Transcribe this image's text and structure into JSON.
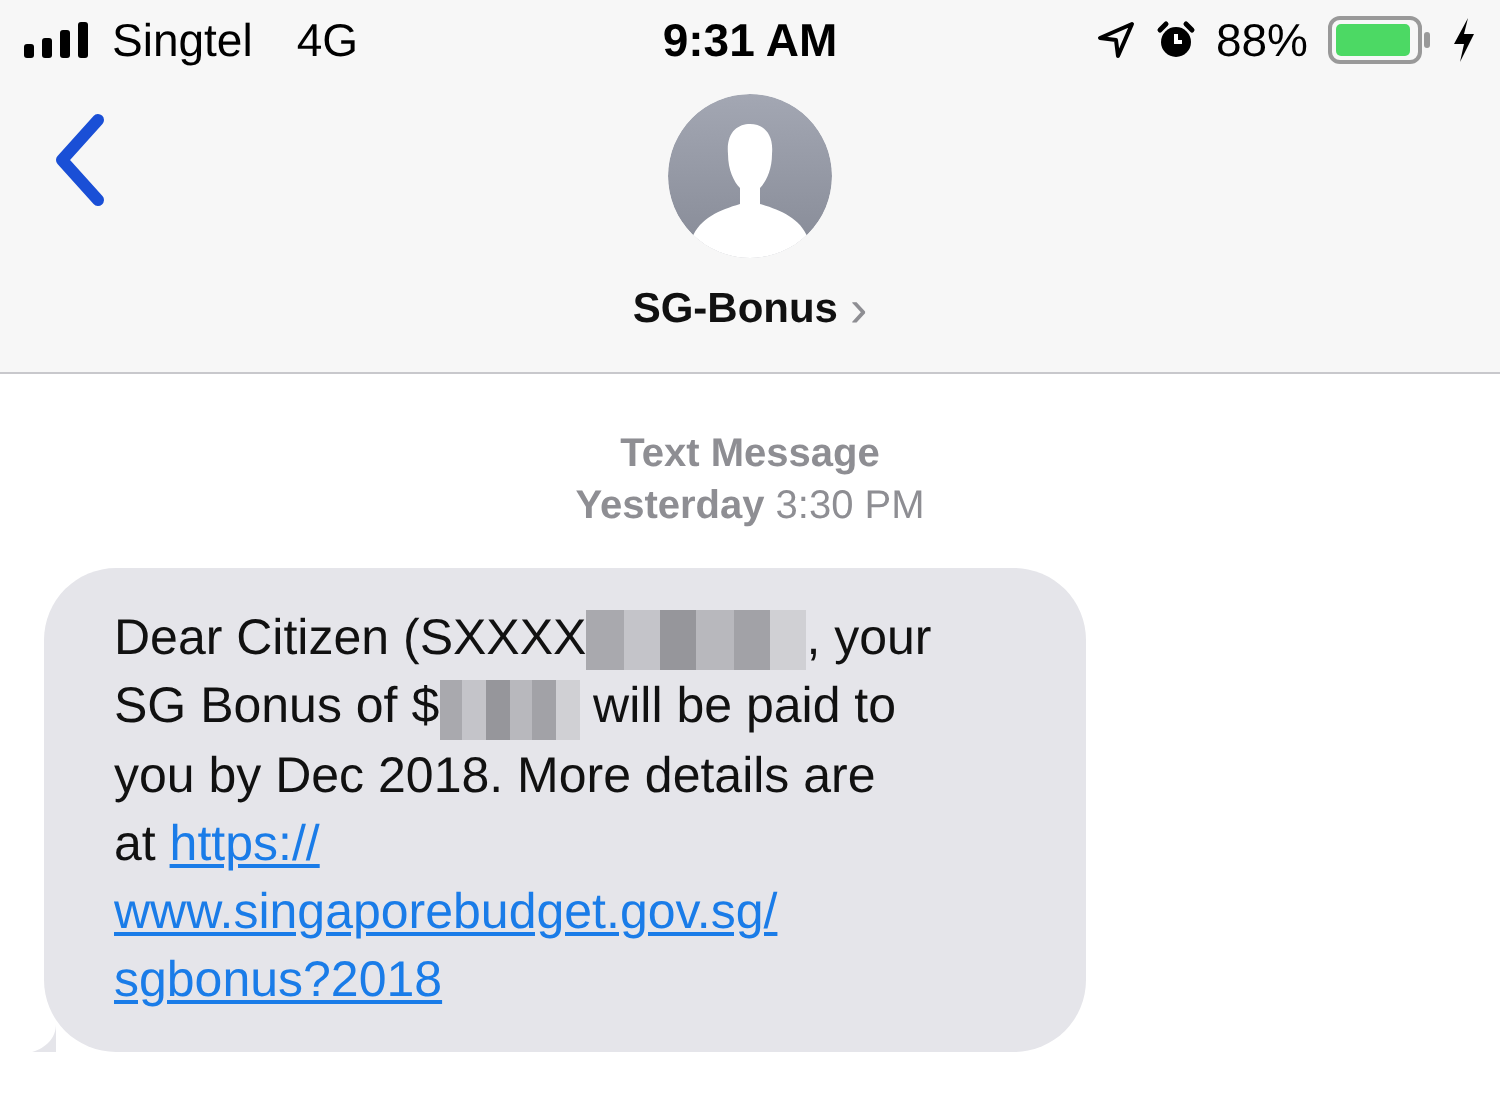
{
  "status_bar": {
    "carrier": "Singtel",
    "network": "4G",
    "time": "9:31 AM",
    "battery_percent": "88%"
  },
  "header": {
    "contact": "SG-Bonus",
    "chevron": "›"
  },
  "timestamp": {
    "service": "Text Message",
    "day": "Yesterday",
    "time": "3:30 PM"
  },
  "message": {
    "lines": [
      [
        {
          "kind": "text",
          "text": "Dear Citizen (SXXXX"
        },
        {
          "kind": "redacted"
        },
        {
          "kind": "text",
          "text": ", your"
        }
      ],
      [
        {
          "kind": "text",
          "text": "SG Bonus of $"
        },
        {
          "kind": "redacted"
        },
        {
          "kind": "text",
          "text": " will be paid to"
        }
      ],
      [
        {
          "kind": "text",
          "text": "you by Dec 2018. More details are"
        }
      ],
      [
        {
          "kind": "text",
          "text": "at "
        },
        {
          "kind": "link",
          "text": "https://"
        }
      ],
      [
        {
          "kind": "link",
          "text": "www.singaporebudget.gov.sg/"
        }
      ],
      [
        {
          "kind": "link",
          "text": "sgbonus?2018"
        }
      ]
    ]
  }
}
